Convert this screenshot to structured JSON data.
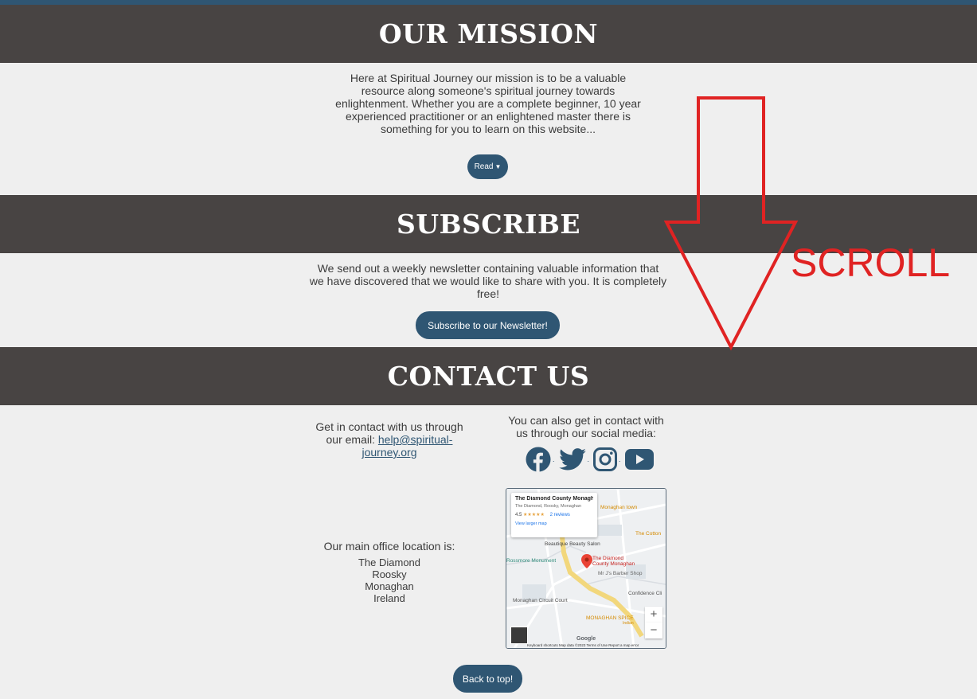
{
  "mission": {
    "heading": "OUR MISSION",
    "body": "Here at Spiritual Journey our mission is to be a valuable resource along someone's spiritual journey towards enlightenment. Whether you are a complete beginner, 10 year experienced practitioner or an enlightened master there is something for you to learn on this website...",
    "read_button": "Read"
  },
  "subscribe": {
    "heading": "SUBSCRIBE",
    "body": "We send out a weekly newsletter containing valuable information that we have discovered that we would like to share with you. It is completely free!",
    "button": "Subscribe to our Newsletter!"
  },
  "contact": {
    "heading": "CONTACT US",
    "email_prefix": "Get in contact with us through our email: ",
    "email": "help@spiritual-journey.org",
    "social_text": "You can also get in contact with us through our social media:",
    "social_icons": [
      "facebook-icon",
      "twitter-icon",
      "instagram-icon",
      "youtube-icon"
    ],
    "office_label": "Our main office location is:",
    "address": [
      "The Diamond",
      "Roosky",
      "Monaghan",
      "Ireland"
    ],
    "back_to_top": "Back to top!"
  },
  "map": {
    "card_title": "The Diamond County Monagh...",
    "card_subtitle": "The Diamond, Roosky, Monaghan",
    "rating": "4.5",
    "stars": "★★★★★",
    "reviews": "2 reviews",
    "view_larger": "View larger map",
    "place_label": "The Diamond County Monaghan",
    "labels": [
      "Beautique Beauty Salon",
      "Mr J's Barber Shop",
      "Confidence Cli",
      "Monaghan Circuit Court",
      "MONAGHAN SPICE",
      "Indian",
      "Rossmore Monument",
      "The Cotton",
      "Monaghan town"
    ],
    "zoom_in": "+",
    "zoom_out": "−",
    "google": "Google",
    "footer": "Keyboard shortcuts   Map data ©2023   Terms of Use   Report a map error"
  },
  "annotation": {
    "scroll_label": "SCROLL"
  },
  "colors": {
    "band": "#484443",
    "accent": "#2f5673",
    "annotation": "#e02323",
    "background": "#efefef"
  }
}
